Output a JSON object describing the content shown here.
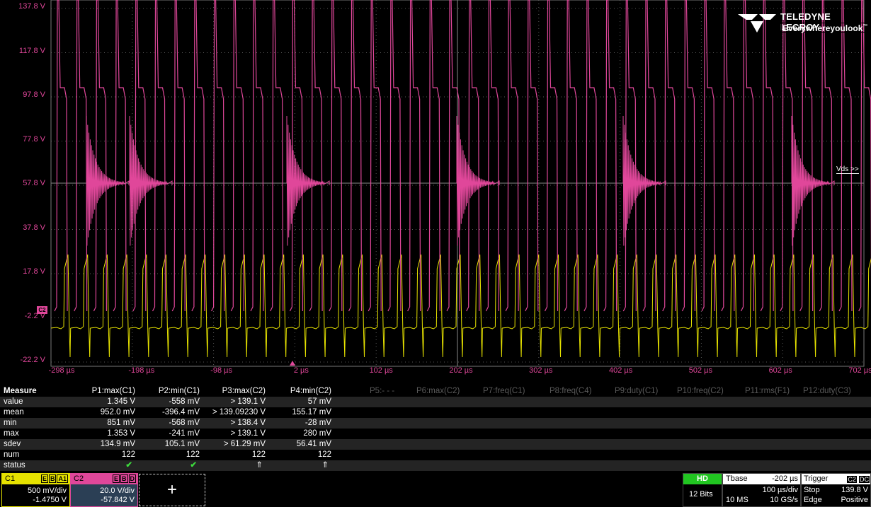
{
  "colors": {
    "c1": "#e6e200",
    "c2": "#e0479a",
    "grid": "#5a5a5a",
    "hd": "#21c621"
  },
  "logo": {
    "brand": "TELEDYNE LECROY",
    "tagline_pre": "Everywhere",
    "tagline_bold": "you",
    "tagline_post": "look"
  },
  "axes": {
    "y_labels": [
      "137.8 V",
      "117.8 V",
      "97.8 V",
      "77.8 V",
      "57.8 V",
      "37.8 V",
      "17.8 V",
      "-2.2 V",
      "-22.2 V"
    ],
    "x_labels": [
      "-298 µs",
      "-198 µs",
      "-98 µs",
      "2 µs",
      "102 µs",
      "202 µs",
      "302 µs",
      "402 µs",
      "502 µs",
      "602 µs",
      "702 µs"
    ]
  },
  "trace_label": "Vds >>",
  "c2_marker": "C2",
  "measure": {
    "title": "Measure",
    "headers": [
      "P1:max(C1)",
      "P2:min(C1)",
      "P3:max(C2)",
      "P4:min(C2)"
    ],
    "inactive_headers": [
      "P5:- - -",
      "P6:max(C2)",
      "P7:freq(C1)",
      "P8:freq(C4)",
      "P9:duty(C1)",
      "P10:freq(C2)",
      "P11:rms(F1)",
      "P12:duty(C3)"
    ],
    "rows": [
      {
        "label": "value",
        "v": [
          "1.345 V",
          "-558 mV",
          "> 139.1 V",
          "57 mV"
        ]
      },
      {
        "label": "mean",
        "v": [
          "952.0 mV",
          "-396.4 mV",
          "> 139.09230 V",
          "155.17 mV"
        ]
      },
      {
        "label": "min",
        "v": [
          "851 mV",
          "-568 mV",
          "> 138.4 V",
          "-28 mV"
        ]
      },
      {
        "label": "max",
        "v": [
          "1.353 V",
          "-241 mV",
          "> 139.1 V",
          "280 mV"
        ]
      },
      {
        "label": "sdev",
        "v": [
          "134.9 mV",
          "105.1 mV",
          "> 61.29 mV",
          "56.41 mV"
        ]
      },
      {
        "label": "num",
        "v": [
          "122",
          "122",
          "122",
          "122"
        ]
      },
      {
        "label": "status",
        "v": [
          "✔",
          "✔",
          "⇑",
          "⇑"
        ]
      }
    ]
  },
  "channels": {
    "c1": {
      "name": "C1",
      "tags": [
        "E",
        "B",
        "A1"
      ],
      "vdiv": "500 mV/div",
      "offset": "-1.4750 V"
    },
    "c2": {
      "name": "C2",
      "tags": [
        "E",
        "B",
        "D"
      ],
      "vdiv": "20.0 V/div",
      "offset": "-57.842 V"
    }
  },
  "add_button": "+",
  "hd": {
    "badge": "HD",
    "bits": "12 Bits"
  },
  "tbase": {
    "label": "Tbase",
    "delay": "-202 µs",
    "tdiv": "100 µs/div",
    "memory": "10 MS",
    "rate": "10 GS/s"
  },
  "trigger": {
    "label": "Trigger",
    "src": "C2",
    "coupling": "DC",
    "mode": "Stop",
    "level": "139.8 V",
    "type": "Edge",
    "slope": "Positive"
  }
}
